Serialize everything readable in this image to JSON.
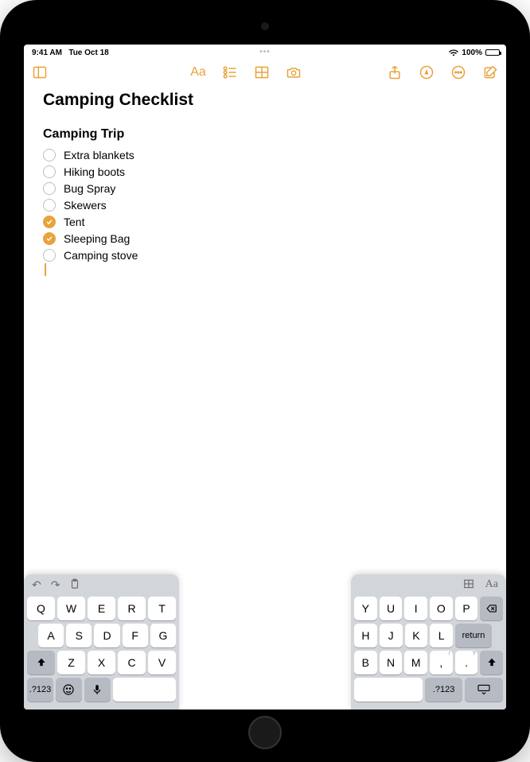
{
  "status": {
    "time": "9:41 AM",
    "date": "Tue Oct 18",
    "battery_pct": "100%"
  },
  "toolbar": {
    "format_label": "Aa"
  },
  "note": {
    "title": "Camping Checklist",
    "heading": "Camping Trip",
    "items": [
      {
        "label": "Extra blankets",
        "checked": false
      },
      {
        "label": "Hiking boots",
        "checked": false
      },
      {
        "label": "Bug Spray",
        "checked": false
      },
      {
        "label": "Skewers",
        "checked": false
      },
      {
        "label": "Tent",
        "checked": true
      },
      {
        "label": "Sleeping Bag",
        "checked": true
      },
      {
        "label": "Camping stove",
        "checked": false
      }
    ]
  },
  "keyboard": {
    "left": {
      "top_icons": [
        "undo-icon",
        "redo-icon",
        "clipboard-icon"
      ],
      "rows": [
        [
          "Q",
          "W",
          "E",
          "R",
          "T"
        ],
        [
          "A",
          "S",
          "D",
          "F",
          "G"
        ],
        [
          "shift",
          "Z",
          "X",
          "C",
          "V"
        ],
        [
          ".?123",
          "emoji",
          "mic",
          "space"
        ]
      ]
    },
    "right": {
      "top_icons": [
        "table-icon",
        "format-icon"
      ],
      "top_format_label": "Aa",
      "rows": [
        [
          "Y",
          "U",
          "I",
          "O",
          "P",
          "backspace"
        ],
        [
          "H",
          "J",
          "K",
          "L",
          "return"
        ],
        [
          "B",
          "N",
          "M",
          "!",
          ",",
          "?",
          ".",
          "shift"
        ],
        [
          "space",
          ".?123",
          "hide-keyboard"
        ]
      ],
      "row3": [
        {
          "k": "B"
        },
        {
          "k": "N"
        },
        {
          "k": "M"
        },
        {
          "k": ",",
          "sub": "!"
        },
        {
          "k": ".",
          "sub": "?"
        },
        {
          "k": "shift"
        }
      ],
      "return_label": "return",
      "sym_label": ".?123"
    },
    "sym_label": ".?123"
  },
  "colors": {
    "accent": "#e8a33c"
  }
}
